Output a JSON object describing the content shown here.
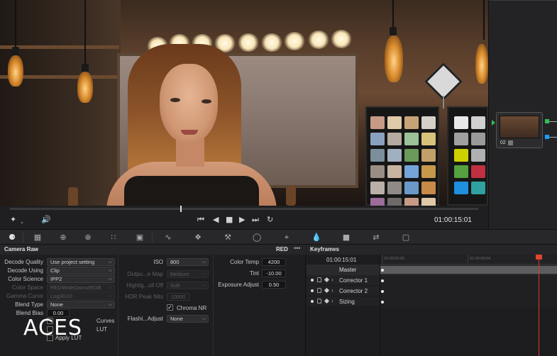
{
  "viewer": {
    "timecode": "01:00:15:01"
  },
  "node_graph": {
    "node_number": "02"
  },
  "camera_raw": {
    "title": "Camera Raw",
    "badge": "RED",
    "menu": "•••",
    "decode_quality": {
      "label": "Decode Quality",
      "value": "Use project setting"
    },
    "decode_using": {
      "label": "Decode Using",
      "value": "Clip"
    },
    "color_science": {
      "label": "Color Science",
      "value": "IPP2"
    },
    "color_space": {
      "label": "Color Space",
      "value": "REDWideGamutRGB"
    },
    "gamma_curve": {
      "label": "Gamma Curve",
      "value": "Log3G10"
    },
    "blend_type": {
      "label": "Blend Type",
      "value": "None"
    },
    "blend_bias": {
      "label": "Blend Bias",
      "value": "0.00"
    },
    "curves_label": "Curves",
    "lut_label": "LUT",
    "apply_lut": "Apply LUT",
    "iso": {
      "label": "ISO",
      "value": "800"
    },
    "output_map": {
      "label": "Outpu...e Map",
      "value": "Medium"
    },
    "highlight_rolloff": {
      "label": "Highlig...oll Off",
      "value": "Soft"
    },
    "hdr_peak": {
      "label": "HDR Peak Nits",
      "value": "10000"
    },
    "chroma_nr": {
      "label": "Chroma NR",
      "checked": true
    },
    "flashing_adjust": {
      "label": "Flashi...Adjust",
      "value": "None"
    },
    "color_temp": {
      "label": "Color Temp",
      "value": "4200"
    },
    "tint": {
      "label": "Tint",
      "value": "-10.00"
    },
    "exposure_adjust": {
      "label": "Exposure Adjust",
      "value": "0.50"
    }
  },
  "overlay_caption": "ACES",
  "keyframes": {
    "title": "Keyframes",
    "timecode": "01:00:15:01",
    "ruler": [
      "01:00:00:00",
      "01:00:08:04"
    ],
    "master_label": "Master",
    "rows": [
      {
        "name": "Corrector 1"
      },
      {
        "name": "Corrector 2"
      },
      {
        "name": "Sizing"
      }
    ]
  },
  "colors": {
    "playhead": "#e0452f",
    "node_green": "#33c14a",
    "node_blue": "#1a9cff"
  }
}
